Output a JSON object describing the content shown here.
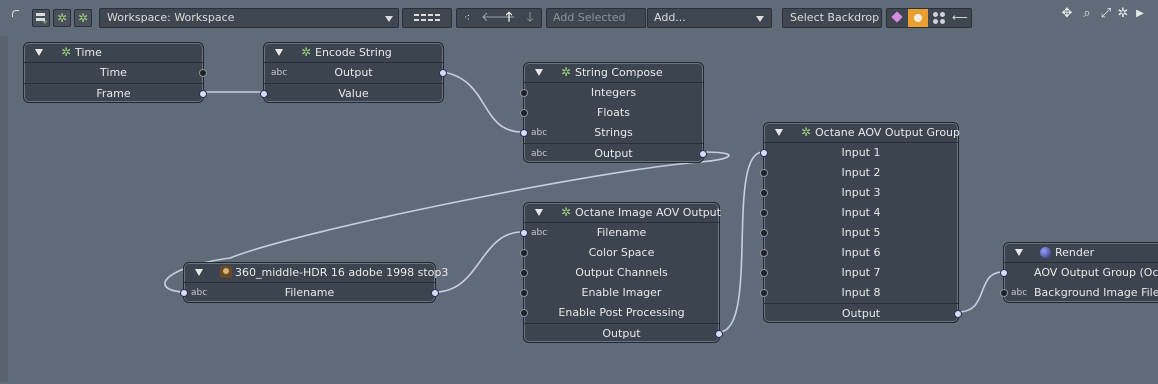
{
  "toolbar": {
    "workspace_label": "Workspace: Workspace",
    "add_selected_placeholder": "Add Selected",
    "add_label": "Add...",
    "select_backdrop_label": "Select Backdrop"
  },
  "nodes": {
    "time": {
      "title": "Time",
      "rows": [
        "Time",
        "Frame"
      ]
    },
    "encode": {
      "title": "Encode String",
      "abc": "abc",
      "rows": [
        "Output",
        "Value"
      ]
    },
    "compose": {
      "title": "String Compose",
      "abc": "abc",
      "rows": [
        "Integers",
        "Floats",
        "Strings",
        "Output"
      ]
    },
    "aov_group": {
      "title": "Octane AOV Output Group",
      "rows": [
        "Input 1",
        "Input 2",
        "Input 3",
        "Input 4",
        "Input 5",
        "Input 6",
        "Input 7",
        "Input 8",
        "Output"
      ]
    },
    "image_aov": {
      "title": "Octane Image AOV Output",
      "abc": "abc",
      "rows": [
        "Filename",
        "Color Space",
        "Output Channels",
        "Enable Imager",
        "Enable Post Processing",
        "Output"
      ]
    },
    "hdr": {
      "title": "360_middle-HDR 16 adobe 1998 stop3",
      "abc": "abc",
      "rows": [
        "Filename"
      ]
    },
    "render": {
      "title": "Render",
      "abc": "abc",
      "rows": [
        "AOV Output Group (Oct...",
        "Background Image Filen..."
      ]
    }
  },
  "icons": [
    "layout-icon",
    "add-gear-icon",
    "gear-icon",
    "grid-icon",
    "tree-icon",
    "arrow-left-icon",
    "arrow-up-icon",
    "arrow-down-icon",
    "dropdown-icon",
    "diamond-icon",
    "circle-icon",
    "dots-icon",
    "collapse-icon",
    "move-icon",
    "zoom-icon",
    "fit-icon",
    "settings-icon",
    "play-icon"
  ],
  "colors": {
    "background": "#5f6b78",
    "node": "#3c4450",
    "wire": "#c9cde0",
    "gear": "#9fd07a",
    "highlight": "#e8a030"
  }
}
